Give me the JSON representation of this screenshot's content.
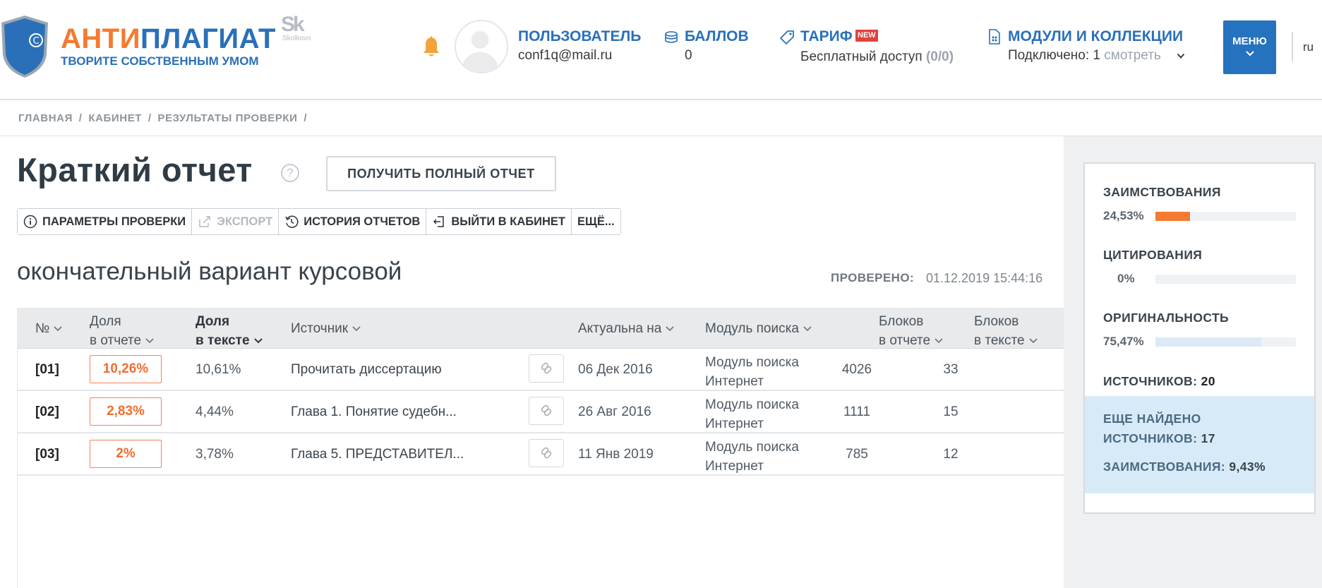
{
  "header": {
    "logo": {
      "word_part1": "АНТИ",
      "word_part2": "ПЛАГИАТ",
      "slogan": "ТВОРИТЕ СОБСТВЕННЫМ УМОМ"
    },
    "partner": {
      "mark": "Sk",
      "name": "Skolkovo"
    },
    "user": {
      "title": "ПОЛЬЗОВАТЕЛЬ",
      "email": "conf1q@mail.ru"
    },
    "points": {
      "title": "БАЛЛОВ",
      "value": "0"
    },
    "tariff": {
      "title": "ТАРИФ",
      "badge": "NEW",
      "value_text": "Бесплатный доступ",
      "value_count": "(0/0)"
    },
    "modules": {
      "title": "МОДУЛИ И КОЛЛЕКЦИИ",
      "connected": "Подключено: 1",
      "view_link": "смотреть"
    },
    "menu_label": "МЕНЮ",
    "language": "ru"
  },
  "breadcrumb": [
    "ГЛАВНАЯ",
    "/",
    "КАБИНЕТ",
    "/",
    "РЕЗУЛЬТАТЫ ПРОВЕРКИ",
    "/"
  ],
  "main": {
    "title": "Краткий отчет",
    "help_glyph": "?",
    "full_report_button": "ПОЛУЧИТЬ ПОЛНЫЙ ОТЧЕТ",
    "toolbar": {
      "params": "ПАРАМЕТРЫ ПРОВЕРКИ",
      "export": "ЭКСПОРТ",
      "history": "ИСТОРИЯ ОТЧЕТОВ",
      "exit": "ВЫЙТИ В КАБИНЕТ",
      "more": "ЕЩЁ..."
    },
    "document_title": "окончательный вариант курсовой",
    "checked_label": "ПРОВЕРЕНО:",
    "checked_value": "01.12.2019 15:44:16"
  },
  "table": {
    "headers": {
      "num": "№",
      "share_report_1": "Доля",
      "share_report_2": "в отчете",
      "share_text_1": "Доля",
      "share_text_2": "в тексте",
      "source": "Источник",
      "actual": "Актуальна на",
      "module": "Модуль поиска",
      "blocks_report_1": "Блоков",
      "blocks_report_2": "в отчете",
      "blocks_text_1": "Блоков",
      "blocks_text_2": "в тексте"
    },
    "rows": [
      {
        "num": "[01]",
        "share_report": "10,26%",
        "share_text": "10,61%",
        "source": "Прочитать диссертацию",
        "date": "06 Дек 2016",
        "module_1": "Модуль поиска",
        "module_2": "Интернет",
        "blocks_report": "4026",
        "blocks_text": "33"
      },
      {
        "num": "[02]",
        "share_report": "2,83%",
        "share_text": "4,44%",
        "source": "Глава 1. Понятие судебн...",
        "date": "26 Авг 2016",
        "module_1": "Модуль поиска",
        "module_2": "Интернет",
        "blocks_report": "1111",
        "blocks_text": "15"
      },
      {
        "num": "[03]",
        "share_report": "2%",
        "share_text": "3,78%",
        "source": "Глава 5. ПРЕДСТАВИТЕЛ...",
        "date": "11 Янв 2019",
        "module_1": "Модуль поиска",
        "module_2": "Интернет",
        "blocks_report": "785",
        "blocks_text": "12"
      }
    ]
  },
  "sidebar": {
    "borrowing": {
      "label": "ЗАИМСТВОВАНИЯ",
      "value": "24,53%",
      "fraction": 0.2453,
      "color": "#f47b30"
    },
    "citation": {
      "label": "ЦИТИРОВАНИЯ",
      "value": "0%",
      "fraction": 0,
      "color": "#2a70b9"
    },
    "originality": {
      "label": "ОРИГИНАЛЬНОСТЬ",
      "value": "75,47%",
      "fraction": 0.7547,
      "color": "#dbeaf6"
    },
    "sources_label": "ИСТОЧНИКОВ:",
    "sources_value": "20",
    "extra_line1": "ЕЩЕ НАЙДЕНО",
    "extra_sources_label": "ИСТОЧНИКОВ:",
    "extra_sources_value": "17",
    "extra_borrow_label": "ЗАИМСТВОВАНИЯ:",
    "extra_borrow_value": "9,43%"
  },
  "colors": {
    "accent_blue": "#2a70b9",
    "accent_orange": "#f47b30",
    "menu_blue": "#2572be"
  }
}
